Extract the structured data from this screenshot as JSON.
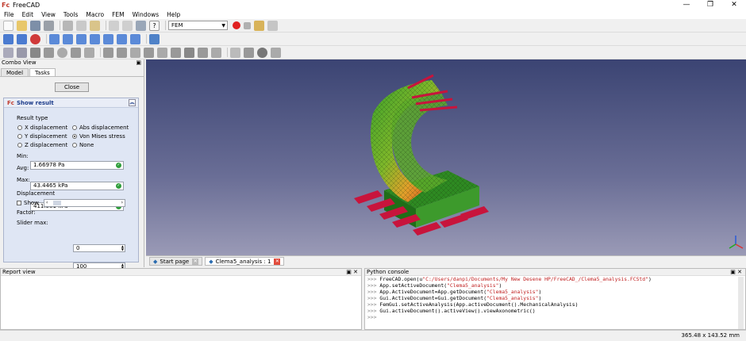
{
  "app": {
    "title": "FreeCAD",
    "logo": "Fc",
    "window_controls": [
      "—",
      "❐",
      "✕"
    ]
  },
  "menu": [
    "File",
    "Edit",
    "View",
    "Tools",
    "Macro",
    "FEM",
    "Windows",
    "Help"
  ],
  "toolbar": {
    "workbench": "FEM"
  },
  "combo": {
    "title": "Combo View",
    "tabs": [
      "Model",
      "Tasks"
    ],
    "close_label": "Close"
  },
  "panel": {
    "title": "Show result",
    "result_type_label": "Result type",
    "options": [
      {
        "label": "X displacement",
        "checked": false
      },
      {
        "label": "Abs displacement",
        "checked": false
      },
      {
        "label": "Y displacement",
        "checked": false
      },
      {
        "label": "Von Mises stress",
        "checked": true
      },
      {
        "label": "Z displacement",
        "checked": false
      },
      {
        "label": "None",
        "checked": false
      }
    ],
    "min_label": "Min:",
    "min_value": "1.66978 Pa",
    "avg_label": "Avg:",
    "avg_value": "43.4465 kPa",
    "max_label": "Max:",
    "max_value": "411.581 kPa",
    "displacement_label": "Displacement",
    "show_label": "Show",
    "factor_label": "Factor:",
    "factor_value": "0",
    "slider_max_label": "Slider max:",
    "slider_max_value": "100"
  },
  "doc_tabs": [
    {
      "label": "Start page"
    },
    {
      "label": "Clema5_analysis : 1"
    }
  ],
  "report": {
    "title": "Report view"
  },
  "python": {
    "title": "Python console",
    "lines": [
      {
        "p": ">>> ",
        "code": "FreeCAD.open(u",
        "str": "\"C:/Users/danpi/Documents/My New Desene HP/FreeCAD_/Clema5_analysis.FCStd\"",
        "end": ")"
      },
      {
        "p": ">>> ",
        "code": "App.setActiveDocument(",
        "str": "\"Clema5_analysis\"",
        "end": ")"
      },
      {
        "p": ">>> ",
        "code": "App.ActiveDocument=App.getDocument(",
        "str": "\"Clema5_analysis\"",
        "end": ")"
      },
      {
        "p": ">>> ",
        "code": "Gui.ActiveDocument=Gui.getDocument(",
        "str": "\"Clema5_analysis\"",
        "end": ")"
      },
      {
        "p": ">>> ",
        "code": "FemGui.setActiveAnalysis(App.activeDocument().MechanicalAnalysis)",
        "str": "",
        "end": ""
      },
      {
        "p": ">>> ",
        "code": "Gui.activeDocument().activeView().viewAxonometric()",
        "str": "",
        "end": ""
      },
      {
        "p": ">>> ",
        "code": "",
        "str": "",
        "end": ""
      }
    ]
  },
  "status": {
    "dimensions": "365.48 x 143.52 mm"
  },
  "colors": {
    "view_top": "#3b4473",
    "view_bottom": "#9a9ab6",
    "mesh_green": "#3aa02c",
    "mesh_yellow": "#e3d22a",
    "mesh_red": "#d23a1f",
    "support_red": "#c8143c"
  }
}
